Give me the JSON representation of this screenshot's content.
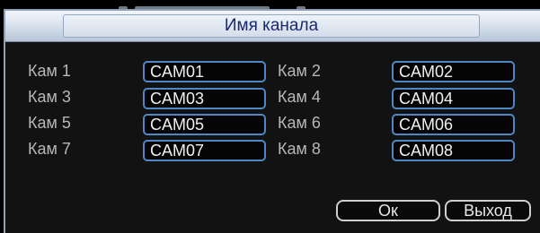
{
  "dialog": {
    "title": "Имя канала"
  },
  "channels": [
    {
      "label": "Кам 1",
      "value": "CAM01"
    },
    {
      "label": "Кам 2",
      "value": "CAM02"
    },
    {
      "label": "Кам 3",
      "value": "CAM03"
    },
    {
      "label": "Кам 4",
      "value": "CAM04"
    },
    {
      "label": "Кам 5",
      "value": "CAM05"
    },
    {
      "label": "Кам 6",
      "value": "CAM06"
    },
    {
      "label": "Кам 7",
      "value": "CAM07"
    },
    {
      "label": "Кам 8",
      "value": "CAM08"
    }
  ],
  "buttons": {
    "ok_label": "Ок",
    "exit_label": "Выход"
  }
}
